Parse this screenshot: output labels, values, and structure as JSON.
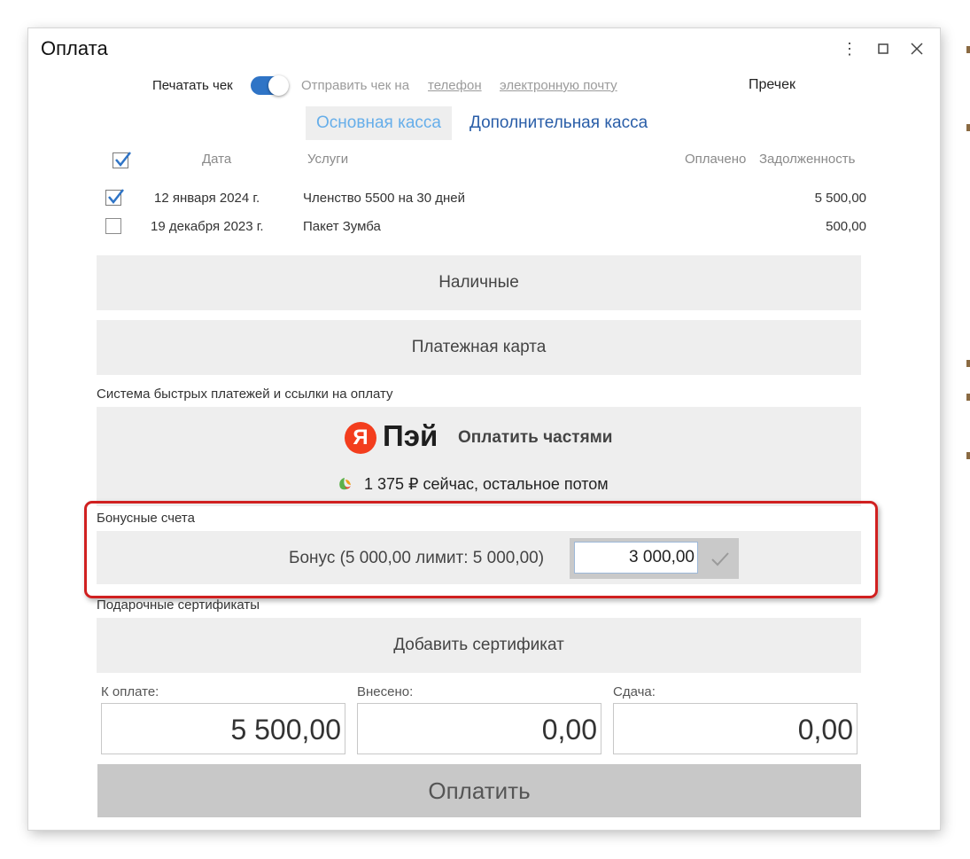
{
  "window": {
    "title": "Оплата"
  },
  "receipt": {
    "print_label": "Печатать чек",
    "print_enabled": true,
    "send_label": "Отправить чек на",
    "phone_link": "телефон",
    "email_link": "электронную почту",
    "precheck": "Пречек"
  },
  "tabs": [
    {
      "label": "Основная касса",
      "active": true
    },
    {
      "label": "Дополнительная касса",
      "active": false
    }
  ],
  "table": {
    "headers": {
      "date": "Дата",
      "service": "Услуги",
      "paid": "Оплачено",
      "debt": "Задолженность"
    },
    "all_checked": true,
    "rows": [
      {
        "checked": true,
        "date": "12 января 2024 г.",
        "service": "Членство 5500 на 30 дней",
        "debt": "5 500,00"
      },
      {
        "checked": false,
        "date": "19 декабря 2023 г.",
        "service": "Пакет Зумба",
        "debt": "500,00"
      }
    ]
  },
  "methods": {
    "cash": "Наличные",
    "card": "Платежная карта"
  },
  "sbp": {
    "section_label": "Система быстрых платежей и ссылки на оплату",
    "logo_letter": "Я",
    "logo_text": "Пэй",
    "parts_label": "Оплатить частями",
    "subline": "1 375 ₽ сейчас, остальное потом"
  },
  "bonus": {
    "section_label": "Бонусные счета",
    "account_label": "Бонус (5 000,00 лимит: 5 000,00)",
    "amount": "3 000,00"
  },
  "certificates": {
    "section_label": "Подарочные сертификаты",
    "add_button": "Добавить сертификат"
  },
  "totals": {
    "to_pay_label": "К оплате:",
    "to_pay": "5 500,00",
    "paid_label": "Внесено:",
    "paid": "0,00",
    "change_label": "Сдача:",
    "change": "0,00"
  },
  "pay_button": "Оплатить",
  "colors": {
    "accent": "#2f74c6",
    "highlight_frame": "#d02020",
    "active_tab_text": "#66aeea",
    "tab_link": "#2a5ea8",
    "yandex_red": "#f33d1d"
  }
}
